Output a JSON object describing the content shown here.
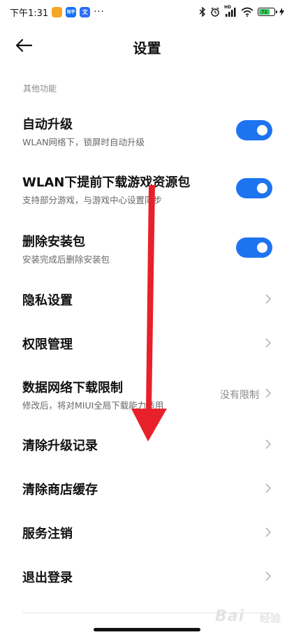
{
  "status_bar": {
    "time": "下午1:31",
    "badges": [
      {
        "name": "message-app-icon",
        "text": "",
        "color": "#f5a623"
      },
      {
        "name": "zhihu-app-icon",
        "text": "知乎",
        "color": "#1772f6"
      },
      {
        "name": "translate-app-icon",
        "text": "文",
        "color": "#2a6ef5"
      }
    ],
    "more": "···",
    "network_label": "HD",
    "battery_level": "71",
    "icons": [
      "bluetooth-icon",
      "alarm-icon",
      "signal-icon",
      "wifi-icon",
      "battery-icon",
      "charging-icon"
    ]
  },
  "header": {
    "title": "设置",
    "back_icon": "back-arrow-icon"
  },
  "section": {
    "header": "其他功能"
  },
  "rows": [
    {
      "title": "自动升级",
      "subtitle": "WLAN网络下，锁屏时自动升级",
      "control": "toggle",
      "on": true
    },
    {
      "title": "WLAN下提前下载游戏资源包",
      "subtitle": "支持部分游戏，与游戏中心设置同步",
      "control": "toggle",
      "on": true
    },
    {
      "title": "删除安装包",
      "subtitle": "安装完成后删除安装包",
      "control": "toggle",
      "on": true
    },
    {
      "title": "隐私设置",
      "control": "chevron"
    },
    {
      "title": "权限管理",
      "control": "chevron"
    },
    {
      "title": "数据网络下载限制",
      "subtitle": "修改后，将对MIUI全局下载能力适用",
      "value": "没有限制",
      "control": "chevron"
    },
    {
      "title": "清除升级记录",
      "control": "chevron"
    },
    {
      "title": "清除商店缓存",
      "control": "chevron"
    },
    {
      "title": "服务注销",
      "control": "chevron"
    },
    {
      "title": "退出登录",
      "control": "chevron"
    }
  ],
  "colors": {
    "toggle_on": "#1e74f0",
    "arrow_annotation": "#e8202a",
    "section_header": "#8a8a8a"
  },
  "watermark": {
    "text": "Bai",
    "sub": "经验"
  }
}
